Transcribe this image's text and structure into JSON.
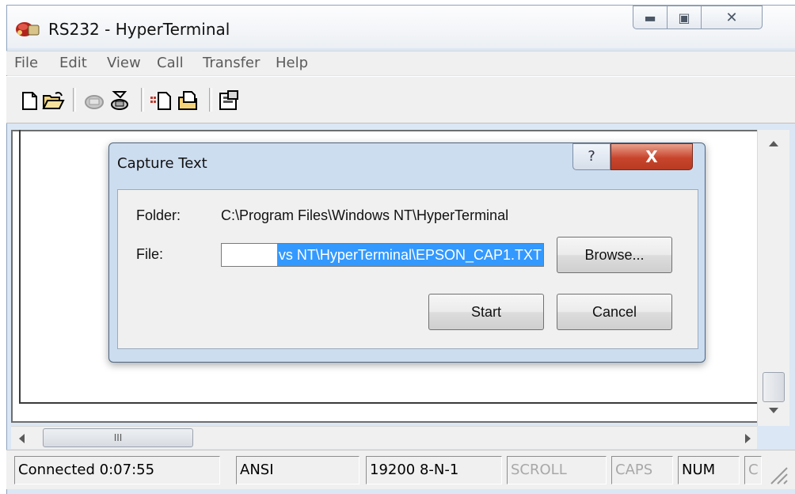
{
  "window": {
    "title": "RS232 - HyperTerminal"
  },
  "menu": {
    "items": [
      "File",
      "Edit",
      "View",
      "Call",
      "Transfer",
      "Help"
    ]
  },
  "toolbar": {
    "icons": [
      "new-icon",
      "open-icon",
      "disconnect-icon",
      "dial-icon",
      "send-icon",
      "receive-icon",
      "properties-icon"
    ]
  },
  "hscroll": {
    "grip": "III"
  },
  "dialog": {
    "title": "Capture Text",
    "help_glyph": "?",
    "close_glyph": "X",
    "folder_label": "Folder:",
    "folder_value": "C:\\Program Files\\Windows NT\\HyperTerminal",
    "file_label": "File:",
    "file_value": "vs NT\\HyperTerminal\\EPSON_CAP1.TXT",
    "browse_label": "Browse...",
    "start_label": "Start",
    "cancel_label": "Cancel"
  },
  "status": {
    "connected": "Connected 0:07:55",
    "emulation": "ANSI",
    "port": "19200 8-N-1",
    "scroll": "SCROLL",
    "caps": "CAPS",
    "num": "NUM",
    "capture": "C"
  }
}
